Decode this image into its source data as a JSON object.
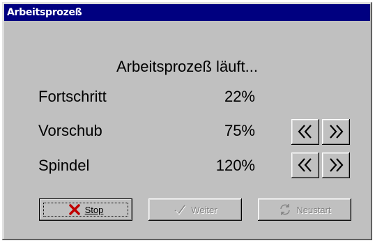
{
  "window": {
    "title": "Arbeitsprozeß"
  },
  "status": {
    "heading": "Arbeitsprozeß läuft..."
  },
  "rows": [
    {
      "label": "Fortschritt",
      "value": "22%"
    },
    {
      "label": "Vorschub",
      "value": "75%"
    },
    {
      "label": "Spindel",
      "value": "120%"
    }
  ],
  "buttons": {
    "stop": {
      "label": "Stop",
      "icon": "x-icon",
      "color": "#c00000"
    },
    "weiter": {
      "label": "Weiter",
      "icon": "checkmark-icon",
      "enabled": false
    },
    "neustart": {
      "label": "Neustart",
      "icon": "refresh-icon",
      "enabled": false
    }
  },
  "arrows": {
    "decrease_icon": "double-chevron-left-icon",
    "increase_icon": "double-chevron-right-icon"
  },
  "colors": {
    "titlebar": "#000080",
    "face": "#c0c0c0"
  }
}
